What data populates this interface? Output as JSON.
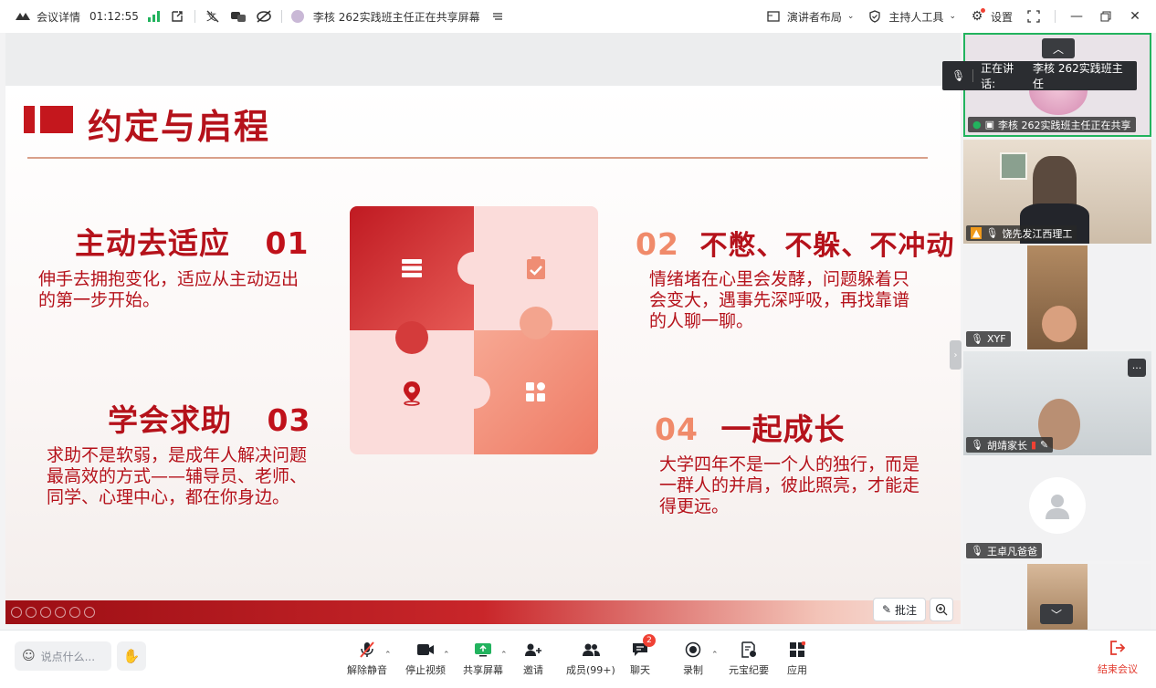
{
  "topbar": {
    "meeting_details": "会议详情",
    "timer": "01:12:55",
    "sharing_status": "李核 262实践班主任正在共享屏幕",
    "presenter_layout": "演讲者布局",
    "host_tools": "主持人工具",
    "settings": "设置"
  },
  "slide": {
    "title": "约定与启程",
    "items": [
      {
        "num": "01",
        "heading": "主动去适应",
        "text": "伸手去拥抱变化，适应从主动迈出的第一步开始。",
        "lines": [
          "伸手去拥抱变化，适应从主动迈出",
          "的第一步开始。"
        ]
      },
      {
        "num": "02",
        "heading": "不憋、不躲、不冲动",
        "lines": [
          "情绪堵在心里会发酵，问题躲着只",
          "会变大，遇事先深呼吸，再找靠谱",
          "的人聊一聊。"
        ]
      },
      {
        "num": "03",
        "heading": "学会求助",
        "lines": [
          "求助不是软弱，是成年人解决问题",
          "最高效的方式——辅导员、老师、",
          "同学、心理中心，都在你身边。"
        ]
      },
      {
        "num": "04",
        "heading": "一起成长",
        "lines": [
          "大学四年不是一个人的独行，而是",
          "一群人的并肩，彼此照亮，才能走",
          "得更远。"
        ]
      }
    ],
    "annotate": "批注"
  },
  "speaking": {
    "prefix": "正在讲话:",
    "name": "李核 262实践班主任"
  },
  "participants": [
    {
      "name": "李核 262实践班主任正在共享"
    },
    {
      "name": "饶先发江西理工"
    },
    {
      "name": "XYF"
    },
    {
      "name": "胡靖家长"
    },
    {
      "name": "王卓凡爸爸"
    }
  ],
  "bottombar": {
    "say_placeholder": "说点什么...",
    "unmute": "解除静音",
    "stop_video": "停止视频",
    "share_screen": "共享屏幕",
    "invite": "邀请",
    "members": "成员(99+)",
    "chat": "聊天",
    "chat_badge": "2",
    "record": "录制",
    "yuanbao": "元宝纪要",
    "apps": "应用",
    "end": "结束会议"
  },
  "colors": {
    "accent_red": "#b5121b",
    "orange": "#f08a6a",
    "end_red": "#e23a2e",
    "signal_green": "#22b35e"
  }
}
